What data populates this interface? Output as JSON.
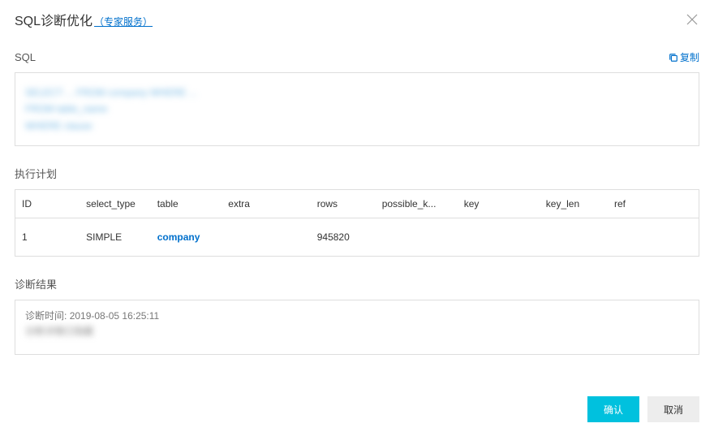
{
  "header": {
    "title": "SQL诊断优化",
    "expert_link": "（专家服务）"
  },
  "sql": {
    "section_label": "SQL",
    "copy_label": "复制",
    "content_obscured": "SELECT ... FROM company WHERE ...",
    "line2": "FROM table_name",
    "line3": "WHERE clause"
  },
  "plan": {
    "section_label": "执行计划",
    "columns": {
      "id": "ID",
      "select_type": "select_type",
      "table": "table",
      "extra": "extra",
      "rows": "rows",
      "possible_keys": "possible_k...",
      "key": "key",
      "key_len": "key_len",
      "ref": "ref"
    },
    "rows": [
      {
        "id": "1",
        "select_type": "SIMPLE",
        "table": "company",
        "extra": "",
        "rows_v": "945820",
        "possible_keys": "",
        "key": "",
        "key_len": "",
        "ref": ""
      }
    ]
  },
  "diagnosis": {
    "section_label": "诊断结果",
    "time_label": "诊断时间:",
    "time_value": "2019-08-05 16:25:11",
    "detail_obscured": "诊断详情已隐藏"
  },
  "footer": {
    "confirm": "确认",
    "cancel": "取消"
  }
}
